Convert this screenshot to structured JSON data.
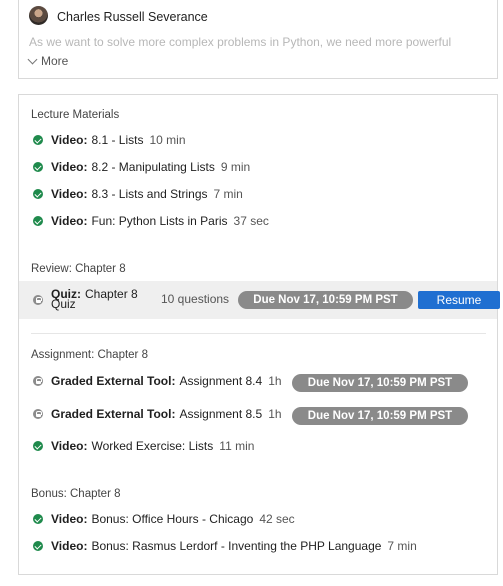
{
  "header": {
    "instructor": "Charles Russell Severance",
    "description": "As we want to solve more complex problems in Python, we need more powerful",
    "more_label": "More"
  },
  "sections": {
    "lecture": {
      "title": "Lecture Materials",
      "items": [
        {
          "type": "Video:",
          "title": "8.1 - Lists",
          "duration": "10 min"
        },
        {
          "type": "Video:",
          "title": "8.2 - Manipulating Lists",
          "duration": "9 min"
        },
        {
          "type": "Video:",
          "title": "8.3 - Lists and Strings",
          "duration": "7 min"
        },
        {
          "type": "Video:",
          "title": "Fun: Python Lists in Paris",
          "duration": "37 sec"
        }
      ]
    },
    "review": {
      "title": "Review: Chapter 8",
      "quiz": {
        "type": "Quiz:",
        "title_line1": "Chapter 8",
        "title_line2": "Quiz",
        "count": "10 questions",
        "due": "Due Nov 17, 10:59 PM PST",
        "resume_label": "Resume"
      }
    },
    "assignment": {
      "title": "Assignment: Chapter 8",
      "items": [
        {
          "type": "Graded External Tool:",
          "title": "Assignment 8.4",
          "duration": "1h",
          "due": "Due Nov 17, 10:59 PM PST"
        },
        {
          "type": "Graded External Tool:",
          "title": "Assignment 8.5",
          "duration": "1h",
          "due": "Due Nov 17, 10:59 PM PST"
        },
        {
          "type": "Video:",
          "title": "Worked Exercise: Lists",
          "duration": "11 min"
        }
      ]
    },
    "bonus": {
      "title": "Bonus: Chapter 8",
      "items": [
        {
          "type": "Video:",
          "title": "Bonus: Office Hours - Chicago",
          "duration": "42 sec"
        },
        {
          "type": "Video:",
          "title": "Bonus: Rasmus Lerdorf - Inventing the PHP Language",
          "duration": "7 min"
        }
      ]
    }
  },
  "colors": {
    "complete": "#1f8a4c",
    "locked": "#8c8c8c",
    "due_pill": "#8a8a8a",
    "resume": "#1f6fd1"
  }
}
